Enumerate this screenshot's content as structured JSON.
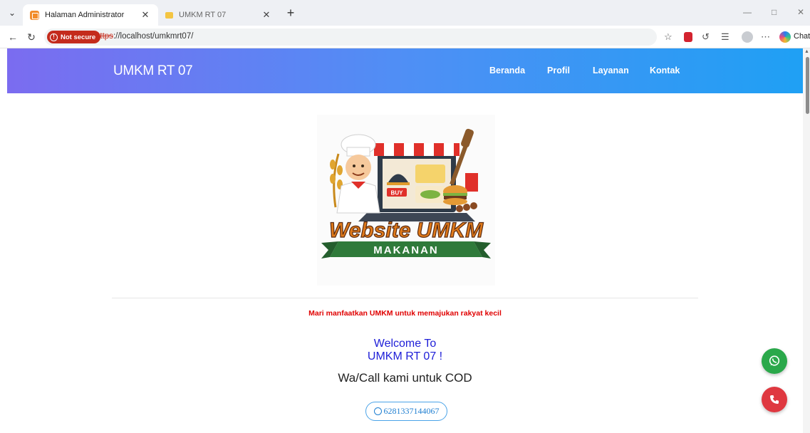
{
  "browser": {
    "tabs": [
      {
        "title": "Halaman Administrator",
        "active": true
      },
      {
        "title": "UMKM RT 07",
        "active": false
      }
    ],
    "security_label": "Not secure",
    "url_scheme": "https",
    "url_rest": "://localhost/umkmrt07/",
    "chat_label": "Chat"
  },
  "site": {
    "brand": "UMKM RT 07",
    "nav": [
      "Beranda",
      "Profil",
      "Layanan",
      "Kontak"
    ],
    "logo": {
      "title": "Website UMKM",
      "banner": "MAKANAN",
      "buy": "BUY"
    },
    "tagline": "Mari manfaatkan UMKM untuk memajukan rakyat kecil",
    "welcome_line1": "Welcome To",
    "welcome_line2": "UMKM RT 07 !",
    "cod": "Wa/Call kami untuk COD",
    "phone": "6281337144067"
  },
  "colors": {
    "nav_gradient_start": "#7b6cf0",
    "nav_gradient_end": "#1fa0f4",
    "tagline": "#e00000",
    "welcome": "#2020d8",
    "whatsapp_button": "#2aa84a",
    "call_button": "#df3840"
  },
  "icons": {
    "whatsapp": "whatsapp-icon",
    "call": "phone-icon"
  }
}
